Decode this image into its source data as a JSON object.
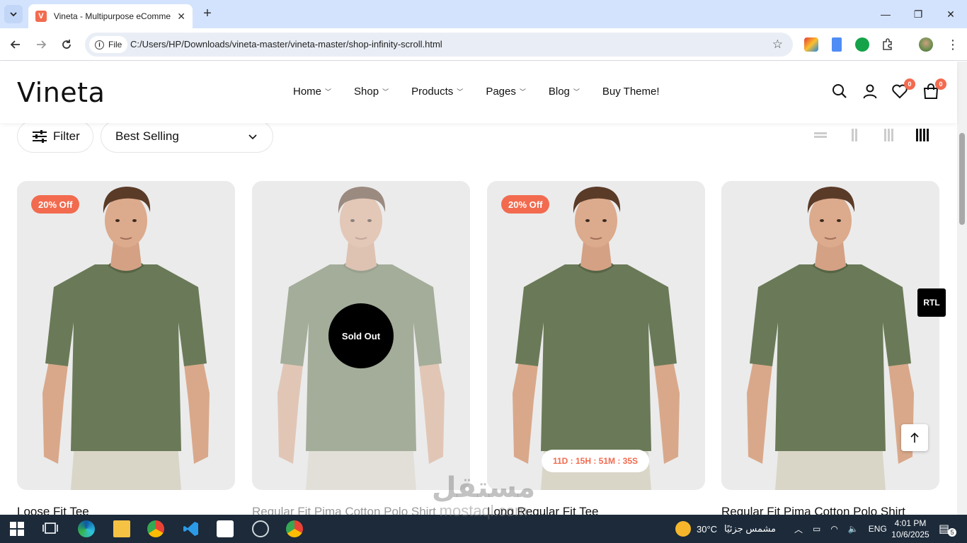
{
  "browser": {
    "tab_title": "Vineta - Multipurpose eComme",
    "tab_favicon_letter": "V",
    "url_chip": "File",
    "url": "C:/Users/HP/Downloads/vineta-master/vineta-master/shop-infinity-scroll.html"
  },
  "site": {
    "logo": "Vineta",
    "nav": [
      {
        "label": "Home",
        "has_dropdown": true
      },
      {
        "label": "Shop",
        "has_dropdown": true
      },
      {
        "label": "Products",
        "has_dropdown": true
      },
      {
        "label": "Pages",
        "has_dropdown": true
      },
      {
        "label": "Blog",
        "has_dropdown": true
      },
      {
        "label": "Buy Theme!",
        "has_dropdown": false
      }
    ],
    "wishlist_count": "0",
    "cart_count": "0",
    "accent_color": "#f26b4f"
  },
  "toolbar": {
    "filter_label": "Filter",
    "sort_label": "Best Selling"
  },
  "products": [
    {
      "name": "Loose Fit Tee",
      "badge": "20% Off"
    },
    {
      "name": "Regular Fit Pima Cotton Polo Shirt",
      "overlay": "Sold Out"
    },
    {
      "name": "Long Regular Fit Tee",
      "badge": "20% Off",
      "countdown": "11D : 15H : 51M : 35S"
    },
    {
      "name": "Regular Fit Pima Cotton Polo Shirt"
    }
  ],
  "floating": {
    "rtl_label": "RTL"
  },
  "watermark": {
    "arabic": "مستقل",
    "latin": "mostaql.com"
  },
  "taskbar": {
    "weather_temp": "30°C",
    "weather_text": "مشمس جزئيًا",
    "language": "ENG",
    "time": "4:01 PM",
    "date": "10/6/2025",
    "notification_count": "5"
  }
}
